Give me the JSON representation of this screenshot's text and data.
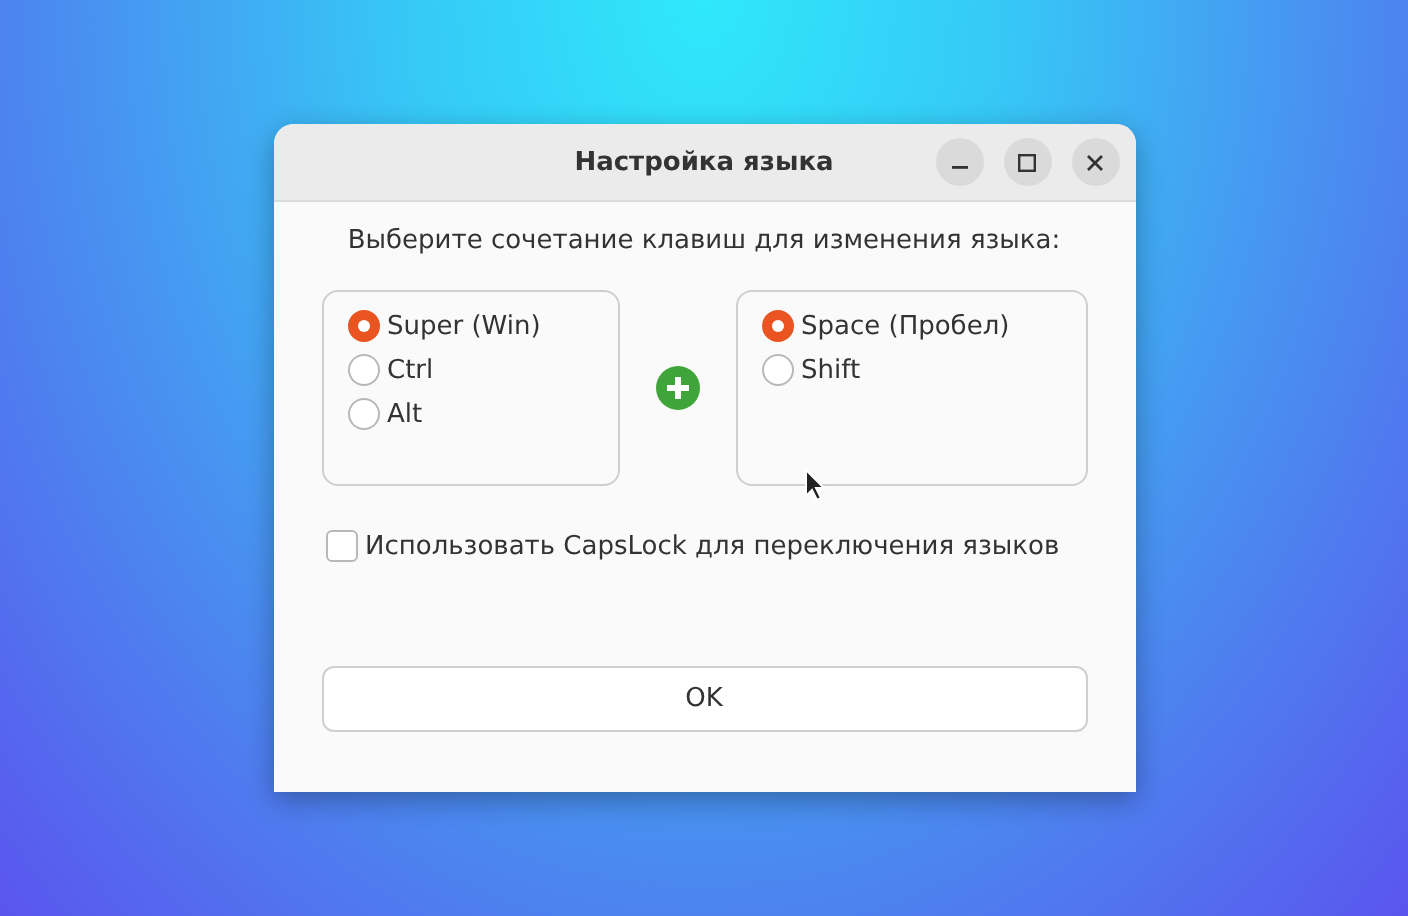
{
  "window": {
    "title": "Настройка языка"
  },
  "prompt": "Выберите сочетание клавиш для изменения языка:",
  "modifier_options": [
    {
      "label": "Super (Win)",
      "selected": true
    },
    {
      "label": "Ctrl",
      "selected": false
    },
    {
      "label": "Alt",
      "selected": false
    }
  ],
  "key_options": [
    {
      "label": "Space (Пробел)",
      "selected": true
    },
    {
      "label": "Shift",
      "selected": false
    }
  ],
  "capslock": {
    "label": "Использовать CapsLock для переключения языков",
    "checked": false
  },
  "buttons": [
    "OK"
  ]
}
